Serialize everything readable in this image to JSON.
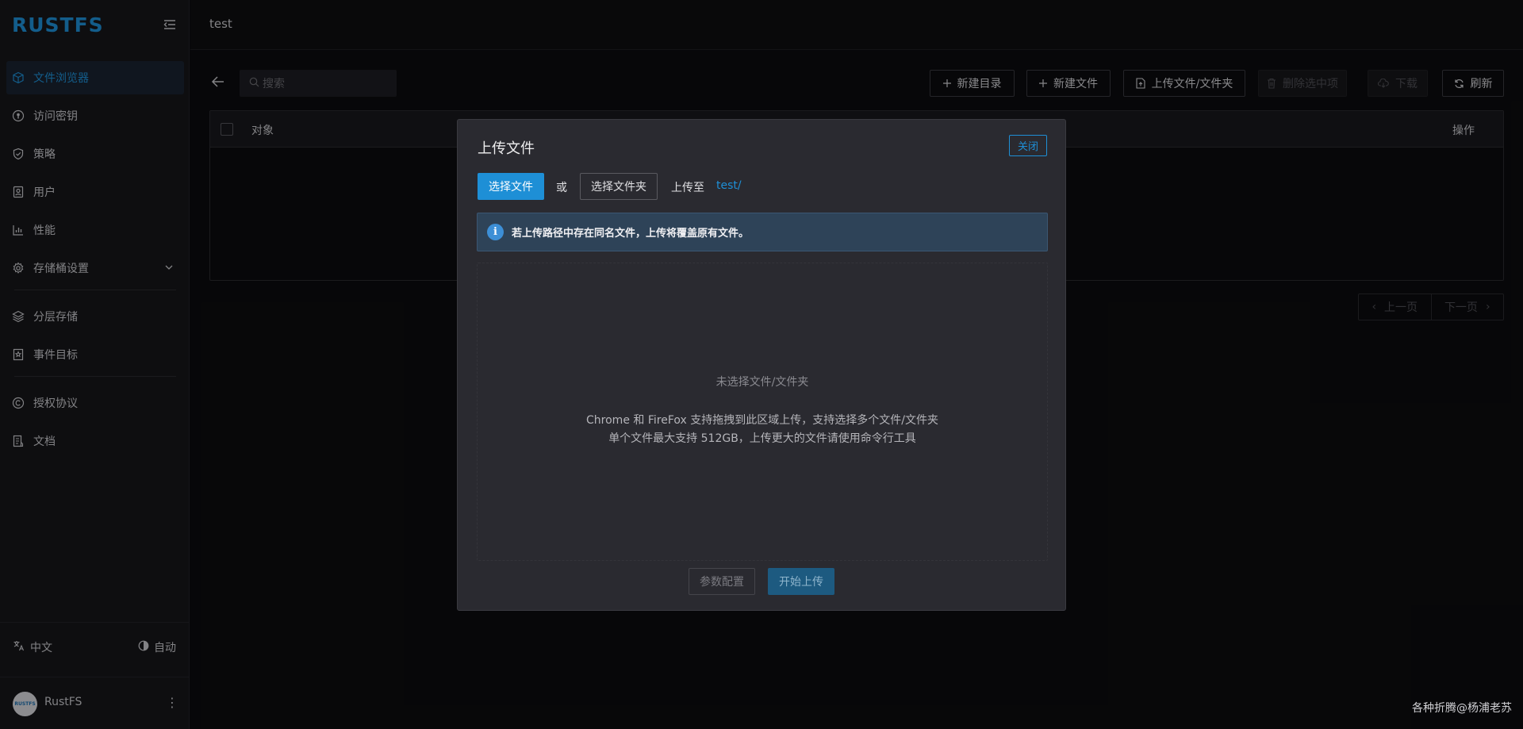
{
  "app": {
    "logo": "RUSTFS",
    "breadcrumb": "test"
  },
  "sidebar": {
    "items": [
      {
        "label": "文件浏览器",
        "icon": "cube-icon",
        "active": true
      },
      {
        "label": "访问密钥",
        "icon": "key-circle-icon"
      },
      {
        "label": "策略",
        "icon": "shield-check-icon"
      },
      {
        "label": "用户",
        "icon": "user-badge-icon"
      },
      {
        "label": "性能",
        "icon": "bar-chart-icon"
      },
      {
        "label": "存储桶设置",
        "icon": "gear-icon",
        "expandable": true
      },
      {
        "label": "分层存储",
        "icon": "layers-icon"
      },
      {
        "label": "事件目标",
        "icon": "bookmark-star-icon"
      },
      {
        "label": "授权协议",
        "icon": "copyright-icon"
      },
      {
        "label": "文档",
        "icon": "document-icon"
      }
    ],
    "language": "中文",
    "theme": "自动",
    "user": {
      "name": "RustFS",
      "avatar_text": "RUSTFS"
    }
  },
  "toolbar": {
    "search_placeholder": "搜索",
    "new_dir": "新建目录",
    "new_file": "新建文件",
    "upload": "上传文件/文件夹",
    "delete_selected": "删除选中项",
    "download": "下载",
    "refresh": "刷新"
  },
  "table": {
    "col_object": "对象",
    "col_actions": "操作"
  },
  "pager": {
    "prev": "上一页",
    "next": "下一页"
  },
  "modal": {
    "title": "上传文件",
    "close": "关闭",
    "choose_file": "选择文件",
    "or": "或",
    "choose_folder": "选择文件夹",
    "upload_to_label": "上传至",
    "upload_path": "test/",
    "info": "若上传路径中存在同名文件，上传将覆盖原有文件。",
    "drop_empty": "未选择文件/文件夹",
    "drop_hint_1": "Chrome 和 FireFox 支持拖拽到此区域上传，支持选择多个文件/文件夹",
    "drop_hint_2": "单个文件最大支持 512GB，上传更大的文件请使用命令行工具",
    "params": "参数配置",
    "start": "开始上传"
  },
  "watermark": "各种折腾@杨浦老苏",
  "colors": {
    "accent": "#1e8fd6",
    "info_bg": "#2e4358",
    "modal_bg": "#2a2a30"
  }
}
